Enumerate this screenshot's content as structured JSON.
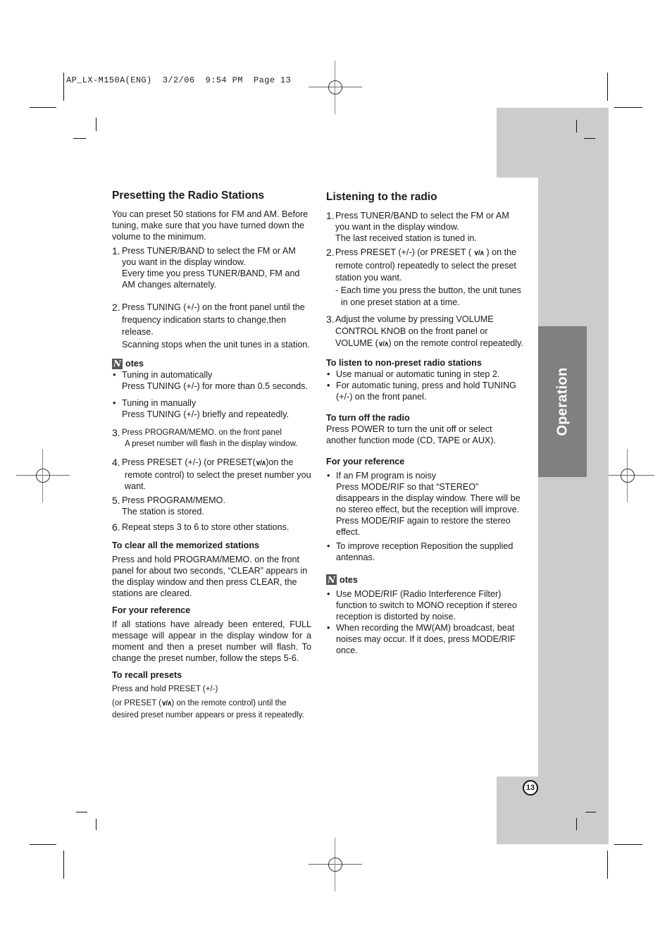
{
  "slug": "AP_LX-M150A(ENG)  3/2/06  9:54 PM  Page 13",
  "section_tab": {
    "label": "Operation"
  },
  "page_number": "13",
  "icons": {
    "arrows": "∨/∧",
    "notes": "N"
  },
  "left": {
    "title": "Presetting the Radio Stations",
    "intro": "You can preset 50 stations for FM and AM. Before tuning, make sure that you have turned down the volume to the minimum.",
    "step1": {
      "num": "1.",
      "text": "Press TUNER/BAND to select the FM or AM you want in the display window.",
      "sub": "Every time you press TUNER/BAND, FM and AM changes alternately."
    },
    "step2": {
      "num": "2.",
      "text": "Press TUNING (+/-) on the front panel until the frequency indication starts to change,then release.",
      "sub": "Scanning stops when the unit tunes in a station."
    },
    "notes": {
      "label": "otes",
      "items": [
        {
          "title": "Tuning in automatically",
          "text": "Press TUNING (+/-) for more than 0.5 seconds."
        },
        {
          "title": "Tuning in manually",
          "text": "Press TUNING (+/-) briefly and repeatedly."
        }
      ]
    },
    "step3": {
      "num": "3.",
      "text": "Press PROGRAM/MEMO. on the front panel",
      "sub": "A preset number will flash in the display window."
    },
    "step4": {
      "num": "4.",
      "text_a": "Press PRESET (+/-) (or PRESET(",
      "text_b": ")on the remote control) to select the preset number you want."
    },
    "step5": {
      "num": "5.",
      "text": "Press PROGRAM/MEMO.",
      "sub": "The station is stored."
    },
    "step6": {
      "num": "6.",
      "text": "Repeat steps 3 to 6 to store other stations."
    },
    "clear": {
      "heading": "To clear all the memorized stations",
      "text": "Press and hold PROGRAM/MEMO. on the front panel for about two seconds, “CLEAR” appears in the display window and then press CLEAR, the stations are cleared."
    },
    "reference": {
      "heading": "For your reference",
      "text": "If all stations have already been entered, FULL message will appear in the display window for a moment and then a preset number will flash. To change the preset number, follow the steps 5-6."
    },
    "recall": {
      "heading": "To recall presets",
      "line1": "Press and hold PRESET (+/-)",
      "line2_a": "(or PRESET (",
      "line2_b": ") on the remote control)  until the desired preset number appears or press it repeatedly."
    }
  },
  "right": {
    "title": "Listening to the radio",
    "step1": {
      "num": "1.",
      "text": "Press TUNER/BAND to select the FM or AM you want in the display window.",
      "sub": "The last received station is tuned in."
    },
    "step2": {
      "num": "2.",
      "text_a": "Press PRESET (+/-) (or PRESET ( ",
      "text_b": " ) on the remote control) repeatedly to select the preset station you want.",
      "sub": "- Each time you press the button, the unit tunes in one preset station at a time."
    },
    "step3": {
      "num": "3.",
      "text_a": "Adjust the volume by pressing VOLUME CONTROL KNOB on the front panel or VOLUME (",
      "text_b": ") on the remote control repeatedly."
    },
    "non_preset": {
      "heading": "To listen to non-preset radio stations",
      "items": [
        "Use manual or automatic tuning in step 2.",
        "For automatic tuning, press and hold TUNING (+/-) on the front panel."
      ]
    },
    "turn_off": {
      "heading": "To  turn off the radio",
      "text": "Press POWER to turn the unit off or select another function mode (CD, TAPE or AUX)."
    },
    "reference": {
      "heading": "For your reference",
      "items": [
        {
          "title": "If an FM program is noisy",
          "text": "Press MODE/RIF so that “STEREO” disappears in the display window. There will be no stereo effect, but the reception will improve. Press MODE/RIF again to restore the stereo effect."
        },
        {
          "title": "",
          "text": "To improve reception Reposition the supplied antennas."
        }
      ]
    },
    "notes": {
      "label": "otes",
      "items": [
        "Use MODE/RIF (Radio Interference Filter) function to switch to MONO reception if stereo reception is distorted by noise.",
        "When recording the MW(AM) broadcast, beat noises may occur. If it does, press MODE/RIF once."
      ]
    }
  }
}
